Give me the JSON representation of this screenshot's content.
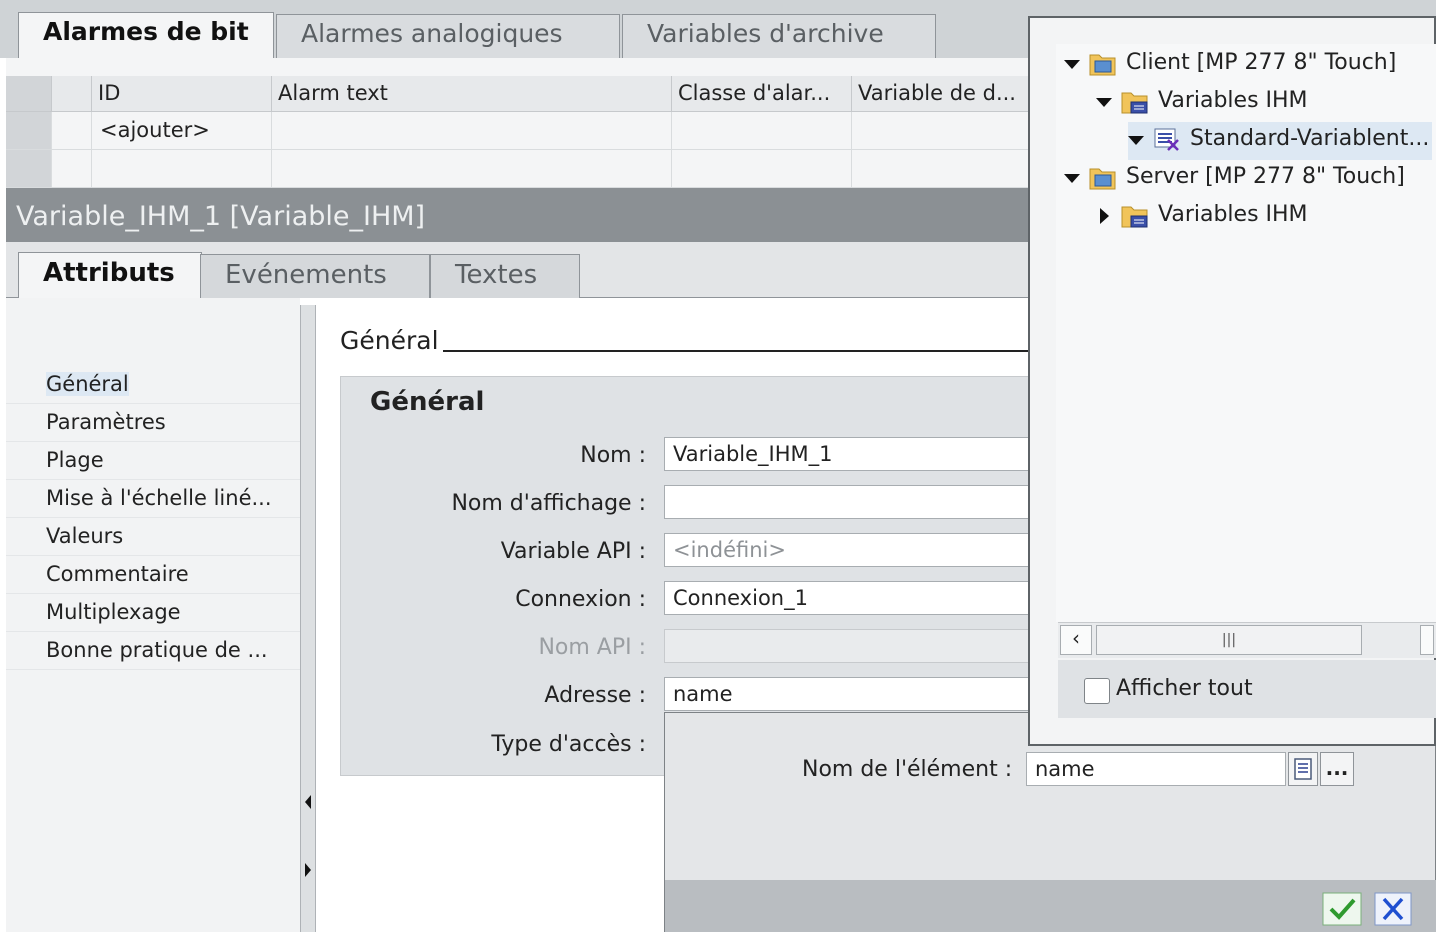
{
  "top_tabs": [
    {
      "label": "Alarmes de bit",
      "active": true
    },
    {
      "label": "Alarmes analogiques",
      "active": false
    },
    {
      "label": "Variables d'archive",
      "active": false
    }
  ],
  "grid": {
    "headers": [
      "ID",
      "Alarm text",
      "Classe d'alar...",
      "Variable de d..."
    ],
    "rows": [
      [
        "<ajouter>",
        "",
        "",
        ""
      ],
      [
        "",
        "",
        "",
        ""
      ]
    ]
  },
  "properties": {
    "title": "Variable_IHM_1 [Variable_IHM]",
    "tabs": [
      {
        "label": "Attributs",
        "active": true
      },
      {
        "label": "Evénements",
        "active": false
      },
      {
        "label": "Textes",
        "active": false
      }
    ]
  },
  "nav": {
    "items": [
      "Général",
      "Paramètres",
      "Plage",
      "Mise à l'échelle liné...",
      "Valeurs",
      "Commentaire",
      "Multiplexage",
      "Bonne pratique de ..."
    ],
    "selected": 0
  },
  "section": {
    "header": "Général",
    "group_title": "Général",
    "fields": {
      "nom": {
        "label": "Nom :",
        "value": "Variable_IHM_1"
      },
      "nom_affichage": {
        "label": "Nom d'affichage :",
        "value": ""
      },
      "variable_api": {
        "label": "Variable API :",
        "placeholder": "<indéfini>"
      },
      "connexion": {
        "label": "Connexion :",
        "value": "Connexion_1"
      },
      "nom_api": {
        "label": "Nom API :",
        "value": ""
      },
      "adresse": {
        "label": "Adresse :",
        "value": "name"
      },
      "type_acces": {
        "label": "Type d'accès :"
      }
    }
  },
  "popup": {
    "element_label": "Nom de l'élément :",
    "element_value": "name",
    "browse_label": "..."
  },
  "tree": {
    "items": [
      {
        "label": "Client [MP 277 8\" Touch]",
        "level": 0,
        "expanded": true,
        "icon": "device-folder-icon"
      },
      {
        "label": "Variables IHM",
        "level": 1,
        "expanded": true,
        "icon": "tags-folder-icon"
      },
      {
        "label": "Standard-Variablent...",
        "level": 2,
        "expanded": true,
        "icon": "tag-table-icon",
        "selected": true
      },
      {
        "label": "Server [MP 277 8\" Touch]",
        "level": 0,
        "expanded": true,
        "icon": "device-folder-icon"
      },
      {
        "label": "Variables IHM",
        "level": 1,
        "expanded": false,
        "icon": "tags-folder-icon"
      }
    ],
    "show_all_label": "Afficher tout",
    "show_all_checked": false
  },
  "colors": {
    "accent_ok": "#2f9a2f",
    "accent_cancel": "#1f4fd0",
    "selection": "#dde8f3"
  }
}
